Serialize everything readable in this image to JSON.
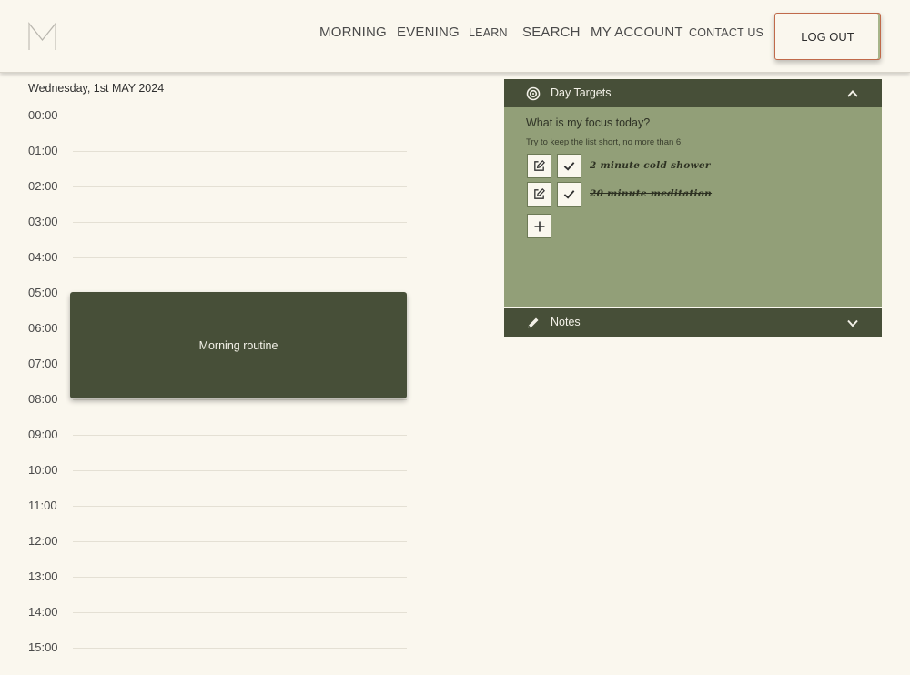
{
  "header": {
    "logo_letter": "M",
    "nav": [
      "MORNING",
      "EVENING",
      "LEARN",
      "SEARCH",
      "MY ACCOUNT",
      "CONTACT US"
    ],
    "logout_label": "LOG OUT"
  },
  "calendar": {
    "date": "Wednesday, 1st MAY 2024",
    "hours": [
      "00:00",
      "01:00",
      "02:00",
      "03:00",
      "04:00",
      "05:00",
      "06:00",
      "07:00",
      "08:00",
      "09:00",
      "10:00",
      "11:00",
      "12:00",
      "13:00",
      "14:00",
      "15:00"
    ],
    "event": {
      "title": "Morning routine"
    }
  },
  "day_targets": {
    "title": "Day Targets",
    "question": "What is my focus today?",
    "hint": "Try to keep the list short, no more than 6.",
    "items": [
      {
        "text": "2 minute cold shower",
        "done": false
      },
      {
        "text": "20 minute meditation",
        "done": true
      }
    ]
  },
  "notes": {
    "title": "Notes"
  },
  "colors": {
    "background": "#faf7ee",
    "dark_green": "#474f38",
    "sage": "#929f78",
    "logout_border": "#c06a4a"
  }
}
